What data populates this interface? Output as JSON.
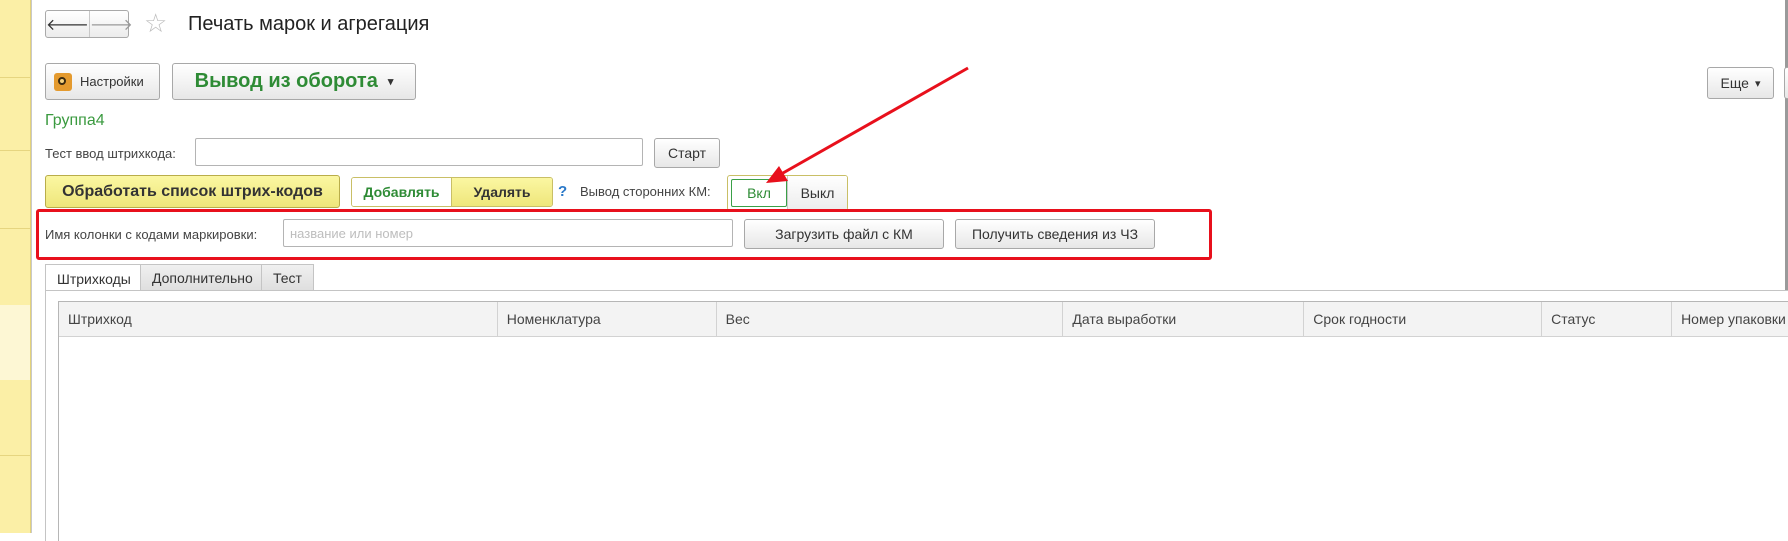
{
  "window": {
    "title": "Печать марок и агрегация",
    "nav_back": "🡐",
    "nav_forward": "🡒",
    "favorite": "☆"
  },
  "toolbar": {
    "settings_label": "Настройки",
    "vyvod_label": "Вывод из оборота",
    "vyvod_arrow": "▾",
    "more_label": "Еще",
    "more_arrow": "▾"
  },
  "group": {
    "title": "Группа4"
  },
  "barcode_test": {
    "label": "Тест ввод штрихкода:",
    "value": "",
    "start_label": "Старт"
  },
  "actions": {
    "process_label": "Обработать список штрих-кодов",
    "add_label": "Добавлять",
    "delete_label": "Удалять",
    "help_label": "?",
    "external_km_label": "Вывод сторонних КМ:",
    "on_label": "Вкл",
    "off_label": "Выкл"
  },
  "marking_column": {
    "label": "Имя колонки с кодами маркировки:",
    "placeholder": "название или номер",
    "value": "",
    "load_label": "Загрузить файл с КМ",
    "fetch_label": "Получить сведения из ЧЗ"
  },
  "tabs": [
    {
      "label": "Штрихкоды",
      "active": true
    },
    {
      "label": "Дополнительно",
      "active": false
    },
    {
      "label": "Тест",
      "active": false
    }
  ],
  "table": {
    "columns": [
      "Штрихкод",
      "Номенклатура",
      "Вес",
      "Дата выработки",
      "Срок годности",
      "Статус",
      "Номер упаковки"
    ],
    "rows": []
  },
  "colors": {
    "accent_green": "#2e8b35",
    "highlight_red": "#e8101c",
    "yellow_button": "#f5ee8e"
  }
}
